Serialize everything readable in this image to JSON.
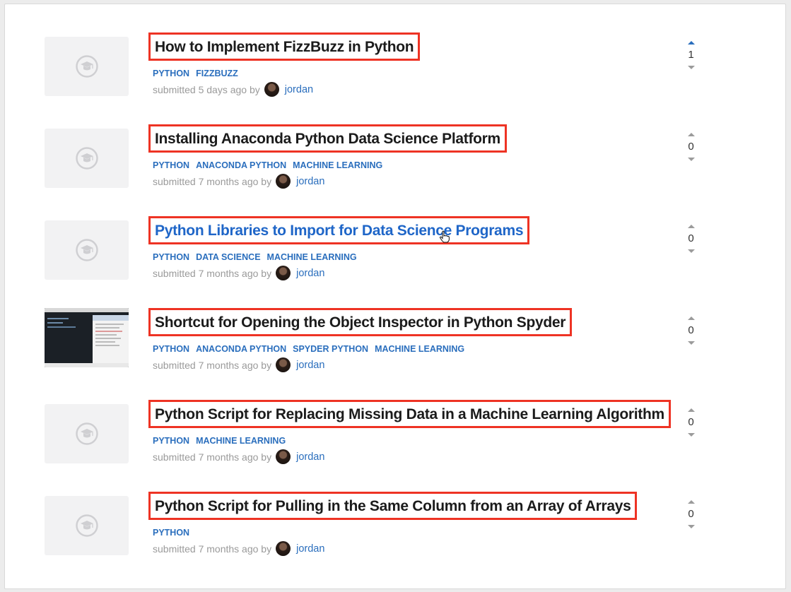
{
  "posts": [
    {
      "title": "How to Implement FizzBuzz in Python",
      "tags": [
        "PYTHON",
        "FIZZBUZZ"
      ],
      "submitted": "submitted 5 days ago by",
      "author": "jordan",
      "votes": "1",
      "upvoted": true,
      "thumb": "placeholder"
    },
    {
      "title": "Installing Anaconda Python Data Science Platform",
      "tags": [
        "PYTHON",
        "ANACONDA PYTHON",
        "MACHINE LEARNING"
      ],
      "submitted": "submitted 7 months ago by",
      "author": "jordan",
      "votes": "0",
      "upvoted": false,
      "thumb": "placeholder"
    },
    {
      "title": "Python Libraries to Import for Data Science Programs",
      "tags": [
        "PYTHON",
        "DATA SCIENCE",
        "MACHINE LEARNING"
      ],
      "submitted": "submitted 7 months ago by",
      "author": "jordan",
      "votes": "0",
      "upvoted": false,
      "thumb": "placeholder",
      "hovered": true
    },
    {
      "title": "Shortcut for Opening the Object Inspector in Python Spyder",
      "tags": [
        "PYTHON",
        "ANACONDA PYTHON",
        "SPYDER PYTHON",
        "MACHINE LEARNING"
      ],
      "submitted": "submitted 7 months ago by",
      "author": "jordan",
      "votes": "0",
      "upvoted": false,
      "thumb": "screenshot"
    },
    {
      "title": "Python Script for Replacing Missing Data in a Machine Learning Algorithm",
      "tags": [
        "PYTHON",
        "MACHINE LEARNING"
      ],
      "submitted": "submitted 7 months ago by",
      "author": "jordan",
      "votes": "0",
      "upvoted": false,
      "thumb": "placeholder"
    },
    {
      "title": "Python Script for Pulling in the Same Column from an Array of Arrays",
      "tags": [
        "PYTHON"
      ],
      "submitted": "submitted 7 months ago by",
      "author": "jordan",
      "votes": "0",
      "upvoted": false,
      "thumb": "placeholder"
    }
  ],
  "colors": {
    "highlight_box": "#ee3324",
    "link_blue": "#2a6ebd",
    "title_text": "#1b1b1b",
    "meta_gray": "#9a9a9a"
  },
  "icons": {
    "placeholder": "graduation-cap-icon",
    "upvote": "caret-up-icon",
    "downvote": "caret-down-icon",
    "cursor": "hand-pointer-icon"
  }
}
